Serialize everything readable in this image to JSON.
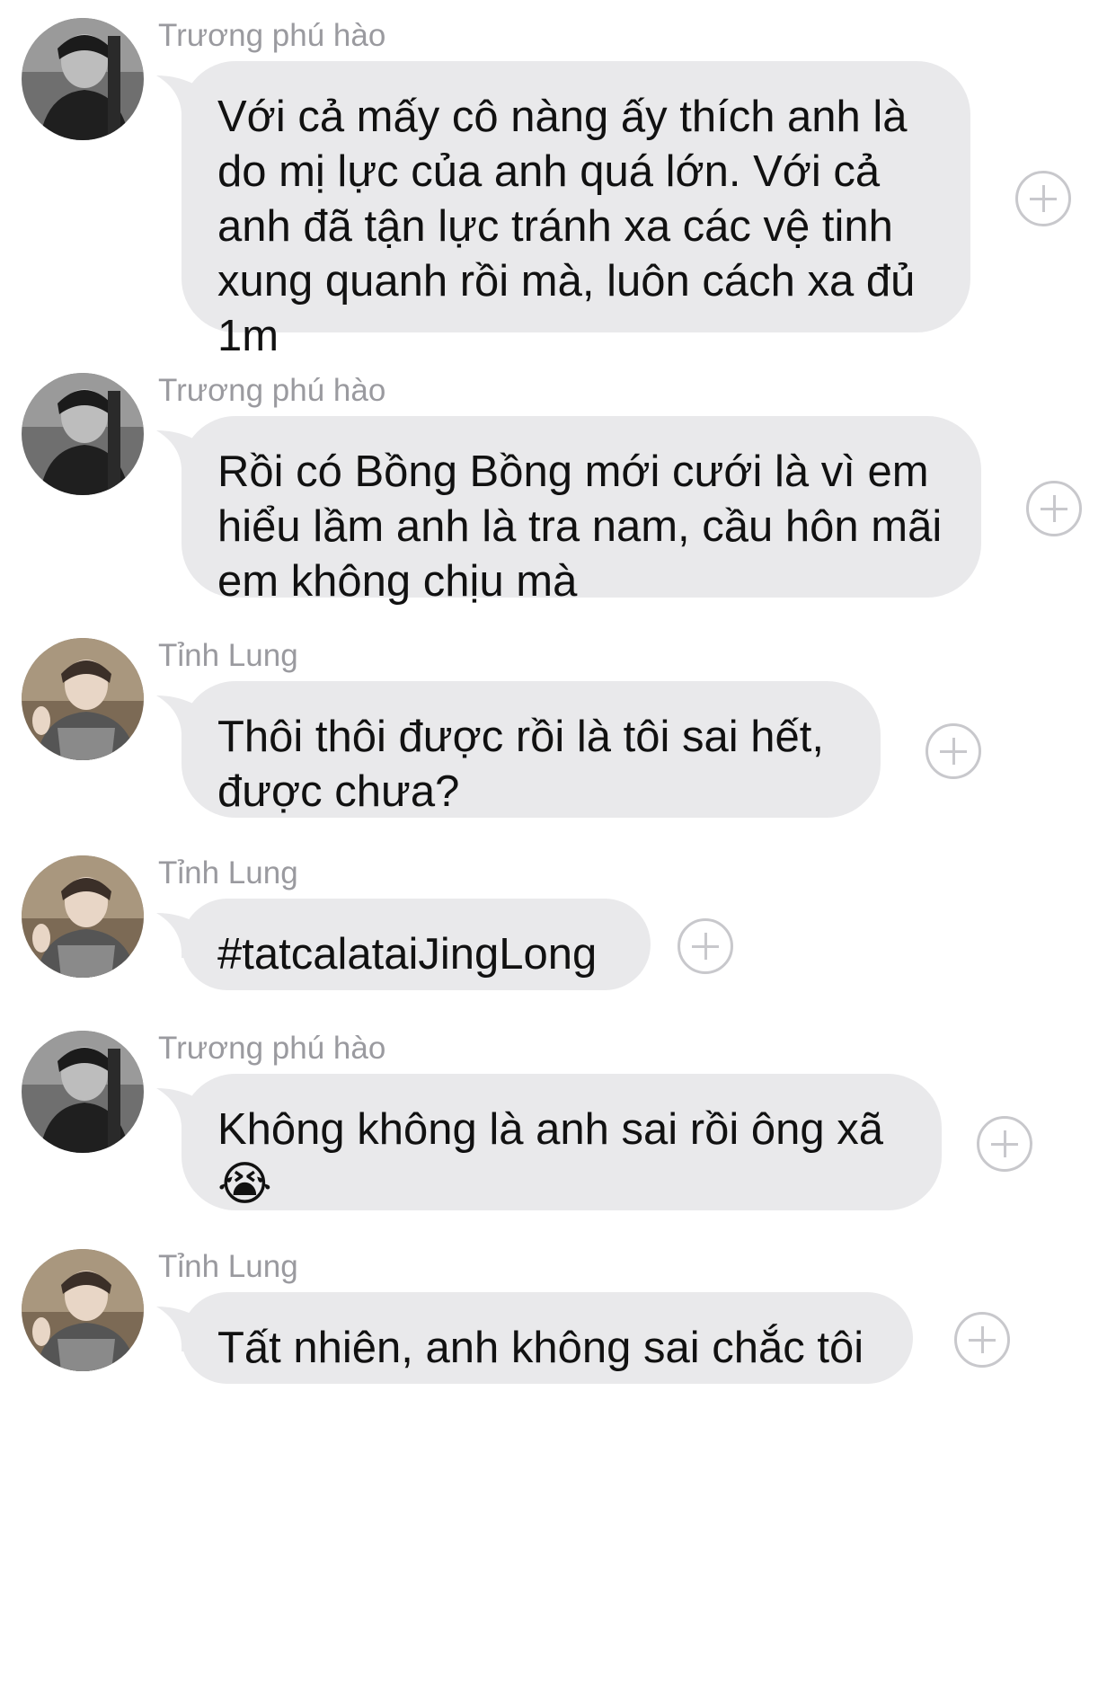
{
  "messages": [
    {
      "sender": "Trương phú hào",
      "avatar": "avatar-truong-phu-hao",
      "text": "Với cả mấy cô nàng ấy thích anh là\ndo mị lực của anh quá lớn. Với cả\nanh đã tận lực tránh xa các vệ tinh\nxung quanh rồi mà, luôn cách xa đủ\n1m"
    },
    {
      "sender": "Trương phú hào",
      "avatar": "avatar-truong-phu-hao",
      "text": "Rồi có Bồng Bồng mới cưới là vì em\nhiểu lầm anh là tra nam, cầu hôn mãi\nem không chịu mà"
    },
    {
      "sender": "Tỉnh Lung",
      "avatar": "avatar-tinh-lung",
      "text": "Thôi thôi được rồi là tôi sai hết,\nđược chưa?"
    },
    {
      "sender": "Tỉnh Lung",
      "avatar": "avatar-tinh-lung",
      "text": "#tatcalataiJingLong"
    },
    {
      "sender": "Trương phú hào",
      "avatar": "avatar-truong-phu-hao",
      "text": "Không không là anh sai rồi ông xã",
      "emoji": "😭"
    },
    {
      "sender": "Tỉnh Lung",
      "avatar": "avatar-tinh-lung",
      "text": "Tất nhiên, anh không sai chắc tôi"
    }
  ],
  "icons": {
    "react": "plus-circle-icon"
  },
  "colors": {
    "bubble": "#e9e9eb",
    "sender_name": "#9a9a9f",
    "message_text": "#111111",
    "react_icon": "#c8c8cc"
  }
}
